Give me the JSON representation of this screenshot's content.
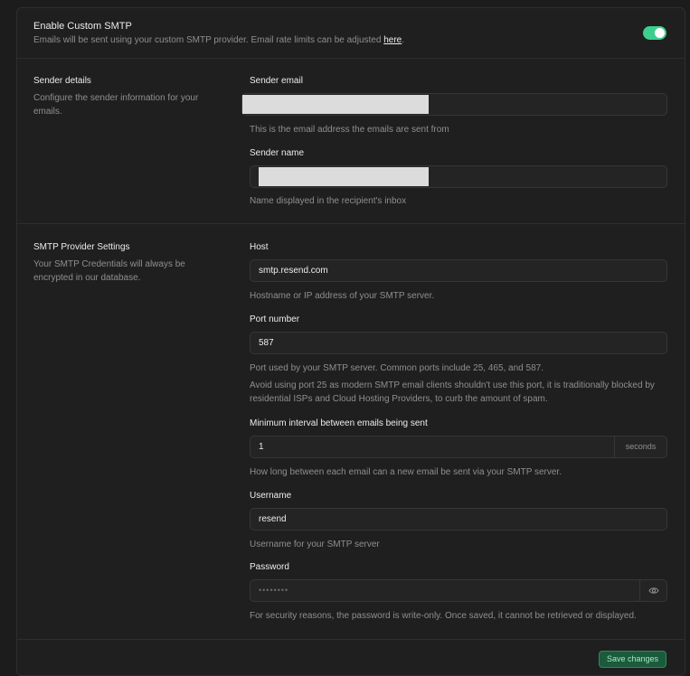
{
  "header": {
    "title": "Enable Custom SMTP",
    "description_prefix": "Emails will be sent using your custom SMTP provider. Email rate limits can be adjusted ",
    "link_text": "here",
    "description_suffix": ".",
    "toggle_on": true
  },
  "sender": {
    "section_title": "Sender details",
    "section_description": "Configure the sender information for your emails.",
    "email_label": "Sender email",
    "email_value": "",
    "email_help": "This is the email address the emails are sent from",
    "name_label": "Sender name",
    "name_value": "",
    "name_help": "Name displayed in the recipient's inbox"
  },
  "smtp": {
    "section_title": "SMTP Provider Settings",
    "section_description": "Your SMTP Credentials will always be encrypted in our database.",
    "host_label": "Host",
    "host_value": "smtp.resend.com",
    "host_help": "Hostname or IP address of your SMTP server.",
    "port_label": "Port number",
    "port_value": "587",
    "port_help": "Port used by your SMTP server. Common ports include 25, 465, and 587.",
    "port_warning": "Avoid using port 25 as modern SMTP email clients shouldn't use this port, it is traditionally blocked by residential ISPs and Cloud Hosting Providers, to curb the amount of spam.",
    "interval_label": "Minimum interval between emails being sent",
    "interval_value": "1",
    "interval_suffix": "seconds",
    "interval_help": "How long between each email can a new email be sent via your SMTP server.",
    "username_label": "Username",
    "username_value": "resend",
    "username_help": "Username for your SMTP server",
    "password_label": "Password",
    "password_value": "••••••••",
    "password_help": "For security reasons, the password is write-only. Once saved, it cannot be retrieved or displayed."
  },
  "footer": {
    "save_label": "Save changes"
  },
  "colors": {
    "accent": "#3ecf8e",
    "background": "#1c1c1c",
    "panel": "#1f1f1f"
  }
}
